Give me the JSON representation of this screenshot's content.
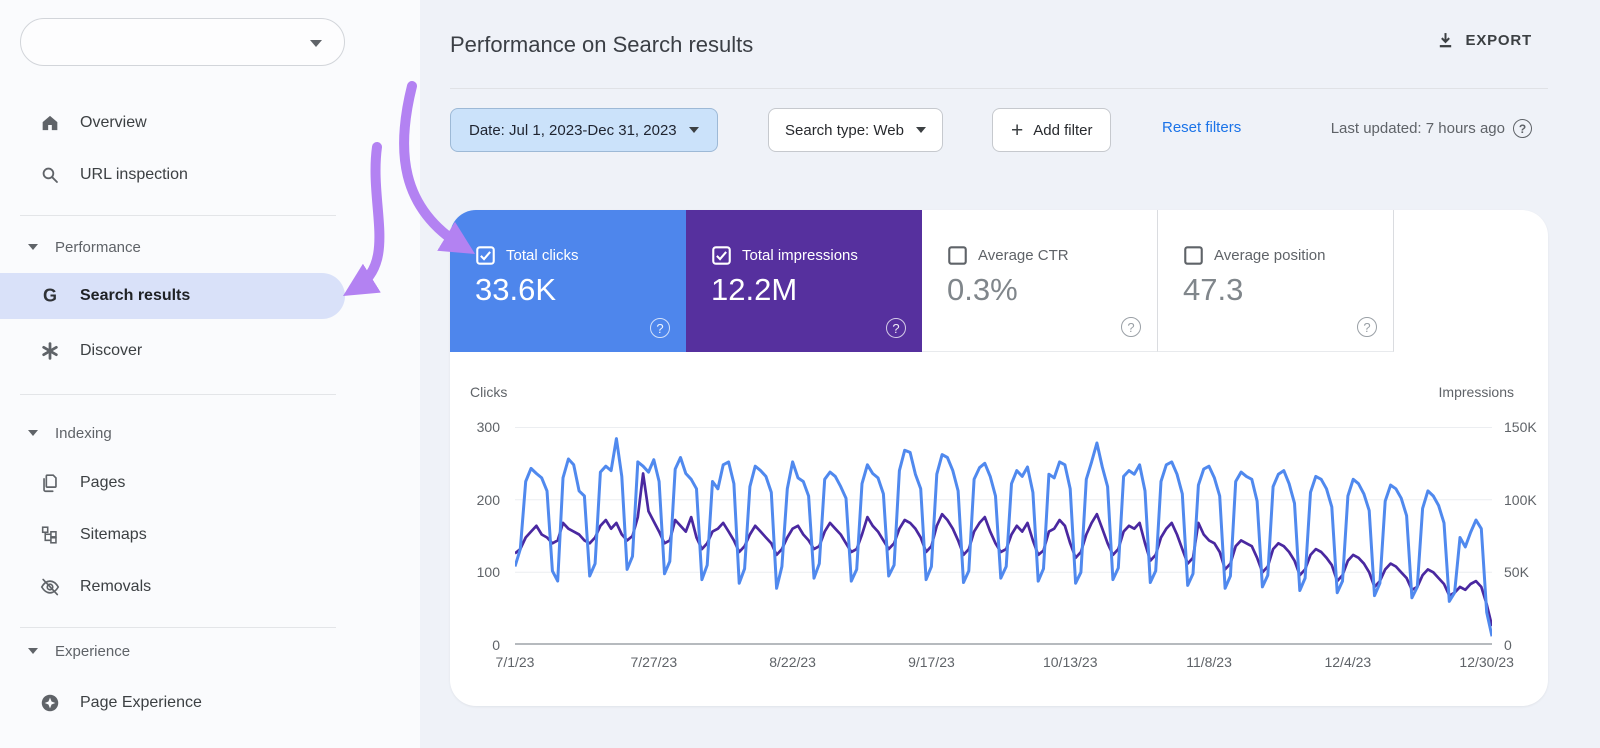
{
  "sidebar": {
    "property_selector": {
      "value": "",
      "icon": "chevron-down-icon"
    },
    "top_items": [
      {
        "label": "Overview",
        "icon": "home-icon"
      },
      {
        "label": "URL inspection",
        "icon": "search-icon"
      }
    ],
    "sections": [
      {
        "label": "Performance",
        "items": [
          {
            "label": "Search results",
            "icon": "google-g-icon",
            "active": true
          },
          {
            "label": "Discover",
            "icon": "discover-asterisk-icon",
            "active": false
          }
        ]
      },
      {
        "label": "Indexing",
        "items": [
          {
            "label": "Pages",
            "icon": "pages-icon",
            "active": false
          },
          {
            "label": "Sitemaps",
            "icon": "sitemaps-icon",
            "active": false
          },
          {
            "label": "Removals",
            "icon": "eye-off-icon",
            "active": false
          }
        ]
      },
      {
        "label": "Experience",
        "items": [
          {
            "label": "Page Experience",
            "icon": "page-experience-icon",
            "active": false
          }
        ]
      }
    ]
  },
  "header": {
    "title": "Performance on Search results",
    "export_label": "EXPORT"
  },
  "filters": {
    "date_label": "Date: Jul 1, 2023-Dec 31, 2023",
    "search_type_label": "Search type: Web",
    "add_filter_label": "Add filter",
    "reset_label": "Reset filters",
    "last_updated": "Last updated: 7 hours ago",
    "help_glyph": "?"
  },
  "metrics": [
    {
      "label": "Total clicks",
      "value": "33.6K",
      "checked": true,
      "color": "#4e86ec"
    },
    {
      "label": "Total impressions",
      "value": "12.2M",
      "checked": true,
      "color": "#56309e"
    },
    {
      "label": "Average CTR",
      "value": "0.3%",
      "checked": false,
      "color": "#ffffff"
    },
    {
      "label": "Average position",
      "value": "47.3",
      "checked": false,
      "color": "#ffffff"
    }
  ],
  "annotations": {
    "arrow_color": "#b382f2",
    "targets": [
      "Search results",
      "Total clicks"
    ]
  },
  "chart_data": {
    "type": "line",
    "axis_left_label": "Clicks",
    "axis_right_label": "Impressions",
    "yticks_left": [
      "300",
      "200",
      "100",
      "0"
    ],
    "yticks_right": [
      "150K",
      "100K",
      "50K",
      "0"
    ],
    "ylim_left": [
      0,
      300
    ],
    "ylim_right": [
      0,
      150000
    ],
    "grid": "horizontal",
    "xticks": [
      "7/1/23",
      "7/27/23",
      "8/22/23",
      "9/17/23",
      "10/13/23",
      "11/8/23",
      "12/4/23",
      "12/30/23"
    ],
    "xtick_indices": [
      0,
      26,
      52,
      78,
      104,
      130,
      156,
      182
    ],
    "date_range": [
      "7/1/23",
      "12/31/23"
    ],
    "series": [
      {
        "name": "Clicks",
        "axis": "left",
        "color": "#5089ee",
        "values": [
          108,
          132,
          225,
          243,
          236,
          230,
          212,
          102,
          88,
          230,
          256,
          248,
          212,
          205,
          95,
          112,
          238,
          246,
          240,
          284,
          232,
          104,
          122,
          252,
          246,
          238,
          255,
          225,
          98,
          115,
          242,
          258,
          236,
          228,
          215,
          90,
          110,
          225,
          215,
          248,
          252,
          222,
          85,
          105,
          218,
          246,
          240,
          232,
          210,
          78,
          108,
          215,
          252,
          230,
          225,
          205,
          92,
          112,
          228,
          238,
          232,
          218,
          202,
          88,
          104,
          222,
          248,
          236,
          230,
          208,
          95,
          110,
          240,
          268,
          265,
          235,
          215,
          90,
          108,
          235,
          262,
          258,
          240,
          212,
          86,
          102,
          228,
          244,
          250,
          232,
          205,
          92,
          108,
          222,
          240,
          232,
          245,
          210,
          88,
          105,
          235,
          230,
          252,
          248,
          215,
          85,
          100,
          228,
          252,
          278,
          245,
          218,
          90,
          106,
          232,
          240,
          235,
          248,
          212,
          86,
          102,
          225,
          248,
          252,
          235,
          208,
          82,
          98,
          220,
          242,
          246,
          230,
          205,
          78,
          95,
          225,
          238,
          232,
          228,
          198,
          80,
          96,
          218,
          235,
          240,
          222,
          195,
          75,
          92,
          210,
          232,
          228,
          215,
          190,
          72,
          88,
          205,
          228,
          222,
          208,
          185,
          68,
          85,
          198,
          220,
          215,
          202,
          178,
          65,
          80,
          188,
          212,
          205,
          192,
          168,
          60,
          72,
          148,
          135,
          155,
          172,
          160,
          45,
          12
        ]
      },
      {
        "name": "Impressions",
        "axis": "right",
        "color": "#4a28a0",
        "values_unit": "thousands",
        "values": [
          63,
          66,
          74,
          78,
          82,
          76,
          74,
          70,
          72,
          84,
          80,
          78,
          76,
          72,
          70,
          74,
          82,
          86,
          80,
          84,
          76,
          72,
          75,
          88,
          118,
          92,
          85,
          78,
          70,
          72,
          86,
          82,
          78,
          88,
          74,
          66,
          70,
          78,
          80,
          84,
          78,
          72,
          64,
          68,
          76,
          82,
          78,
          74,
          70,
          62,
          66,
          74,
          80,
          82,
          76,
          72,
          66,
          68,
          78,
          84,
          80,
          76,
          70,
          64,
          66,
          76,
          88,
          82,
          78,
          72,
          66,
          70,
          80,
          86,
          84,
          80,
          74,
          64,
          68,
          82,
          90,
          86,
          80,
          72,
          62,
          66,
          78,
          84,
          88,
          78,
          70,
          64,
          66,
          76,
          82,
          78,
          84,
          72,
          62,
          65,
          78,
          80,
          86,
          82,
          70,
          60,
          64,
          76,
          84,
          90,
          80,
          70,
          62,
          66,
          78,
          82,
          80,
          84,
          70,
          58,
          62,
          74,
          80,
          84,
          76,
          66,
          56,
          60,
          84,
          76,
          72,
          70,
          64,
          52,
          56,
          68,
          72,
          70,
          68,
          60,
          50,
          54,
          66,
          70,
          68,
          64,
          58,
          48,
          52,
          62,
          66,
          64,
          60,
          55,
          44,
          48,
          58,
          62,
          60,
          56,
          50,
          40,
          44,
          52,
          56,
          54,
          50,
          46,
          38,
          40,
          48,
          52,
          50,
          46,
          42,
          34,
          36,
          40,
          38,
          42,
          44,
          40,
          28,
          13
        ]
      }
    ]
  }
}
